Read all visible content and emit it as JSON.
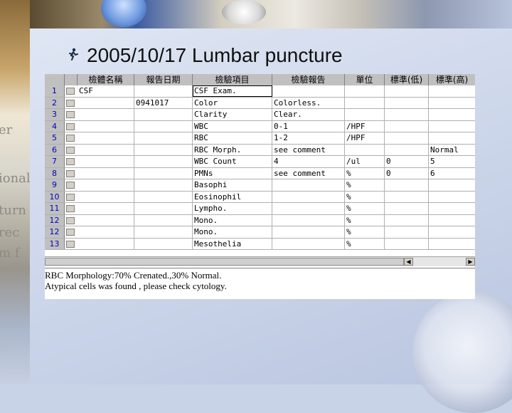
{
  "slide": {
    "title": "2005/10/17  Lumbar puncture",
    "bullet_icon": "runner-icon"
  },
  "grid": {
    "headers": [
      "檢體名稱",
      "報告日期",
      "檢驗項目",
      "檢驗報告",
      "單位",
      "標準(低)",
      "標準(高)"
    ],
    "rows": [
      {
        "num": "1",
        "specimen": "CSF",
        "date": "",
        "item": "CSF Exam.",
        "result": "",
        "unit": "",
        "low": "",
        "high": ""
      },
      {
        "num": "2",
        "specimen": "",
        "date": "0941017",
        "item": "Color",
        "result": "Colorless.",
        "unit": "",
        "low": "",
        "high": ""
      },
      {
        "num": "3",
        "specimen": "",
        "date": "",
        "item": "Clarity",
        "result": "Clear.",
        "unit": "",
        "low": "",
        "high": ""
      },
      {
        "num": "4",
        "specimen": "",
        "date": "",
        "item": "WBC",
        "result": "0-1",
        "unit": "/HPF",
        "low": "",
        "high": ""
      },
      {
        "num": "5",
        "specimen": "",
        "date": "",
        "item": "RBC",
        "result": "1-2",
        "unit": "/HPF",
        "low": "",
        "high": ""
      },
      {
        "num": "6",
        "specimen": "",
        "date": "",
        "item": "RBC Morph.",
        "result": "see comment",
        "unit": "",
        "low": "",
        "high": "Normal"
      },
      {
        "num": "7",
        "specimen": "",
        "date": "",
        "item": "WBC Count",
        "result": "4",
        "unit": "/ul",
        "low": "0",
        "high": "5"
      },
      {
        "num": "8",
        "specimen": "",
        "date": "",
        "item": "PMNs",
        "result": "see comment",
        "unit": "%",
        "low": "0",
        "high": "6"
      },
      {
        "num": "9",
        "specimen": "",
        "date": "",
        "item": "Basophi",
        "result": "",
        "unit": "%",
        "low": "",
        "high": ""
      },
      {
        "num": "10",
        "specimen": "",
        "date": "",
        "item": "Eosinophil",
        "result": "",
        "unit": "%",
        "low": "",
        "high": ""
      },
      {
        "num": "11",
        "specimen": "",
        "date": "",
        "item": "Lympho.",
        "result": "",
        "unit": "%",
        "low": "",
        "high": ""
      },
      {
        "num": "12",
        "specimen": "",
        "date": "",
        "item": "Mono.",
        "result": "",
        "unit": "%",
        "low": "",
        "high": ""
      },
      {
        "num": "12",
        "specimen": "",
        "date": "",
        "item": "Mono.",
        "result": "",
        "unit": "%",
        "low": "",
        "high": ""
      },
      {
        "num": "13",
        "specimen": "",
        "date": "",
        "item": "Mesothelia",
        "result": "",
        "unit": "%",
        "low": "",
        "high": ""
      }
    ]
  },
  "notes": {
    "line1": "RBC Morphology:70% Crenated.,30% Normal.",
    "line2": "Atypical cells was found , please check cytology."
  },
  "background": {
    "left_text": [
      "er",
      "ional",
      "turn",
      "rec",
      "m f"
    ]
  }
}
